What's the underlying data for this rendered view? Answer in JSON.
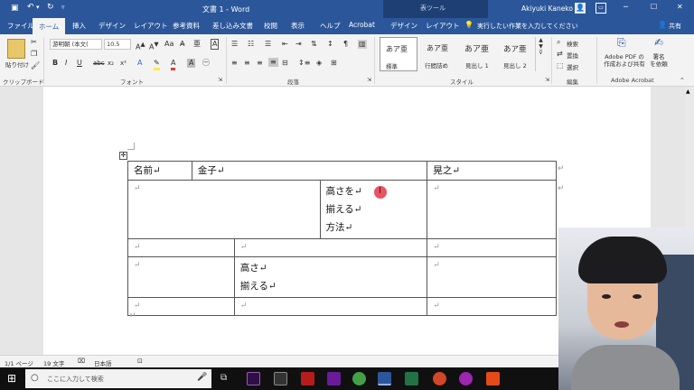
{
  "titlebar": {
    "save_icon": "save-icon",
    "title": "文書 1  -  Word",
    "context_title": "表ツール",
    "user": "Akiyuki Kaneko",
    "minimize": "─",
    "maximize": "☐",
    "close": "✕"
  },
  "tabs": [
    "ファイル",
    "ホーム",
    "挿入",
    "デザイン",
    "レイアウト",
    "参考資料",
    "差し込み文書",
    "校閲",
    "表示",
    "ヘルプ",
    "Acrobat",
    "デザイン",
    "レイアウト"
  ],
  "tell_me": "実行したい作業を入力してください",
  "share": "共有",
  "ribbon": {
    "paste": "貼り付け",
    "clipboard": "クリップボード",
    "font_name": "游明朝 (本文(",
    "font_size": "10.5",
    "font_group": "フォント",
    "paragraph_group": "段落",
    "styles": [
      {
        "preview": "あア亜",
        "name": "標準"
      },
      {
        "preview": "あア亜",
        "name": "行間詰め"
      },
      {
        "preview": "あア亜",
        "name": "見出し 1"
      },
      {
        "preview": "あア亜",
        "name": "見出し 2"
      }
    ],
    "style_group": "スタイル",
    "search": "検索",
    "replace": "置換",
    "select": "選択",
    "edit_group": "編集",
    "pdf_create": "Adobe PDF の\n作成および共有",
    "sign": "署名\nを依頼",
    "acrobat_group": "Adobe Acrobat",
    "bold": "B",
    "italic": "I",
    "underline": "U",
    "strike": "abc",
    "sub": "x₂",
    "sup": "x²"
  },
  "table": {
    "row1": [
      "名前↵",
      "金子↵",
      "晃之↵"
    ],
    "row2_c1": "↵",
    "row2_c2": [
      "高さを↵",
      "揃える↵",
      "方法↵"
    ],
    "row2_c3": "↵",
    "row3": [
      "↵",
      "↵",
      "↵"
    ],
    "row4_c1": "↵",
    "row4_c2": [
      "高さ↵",
      "揃える↵"
    ],
    "row4_c3": "↵",
    "row5": [
      "↵",
      "↵",
      "↵"
    ],
    "after": "↵",
    "row_end": "↵"
  },
  "status": {
    "page": "1/1 ページ",
    "words": "19 文字",
    "lang": "日本語"
  },
  "taskbar": {
    "search_placeholder": "ここに入力して検索"
  },
  "colors": {
    "word_blue": "#2b579a",
    "cursor_red": "#e8354a"
  }
}
